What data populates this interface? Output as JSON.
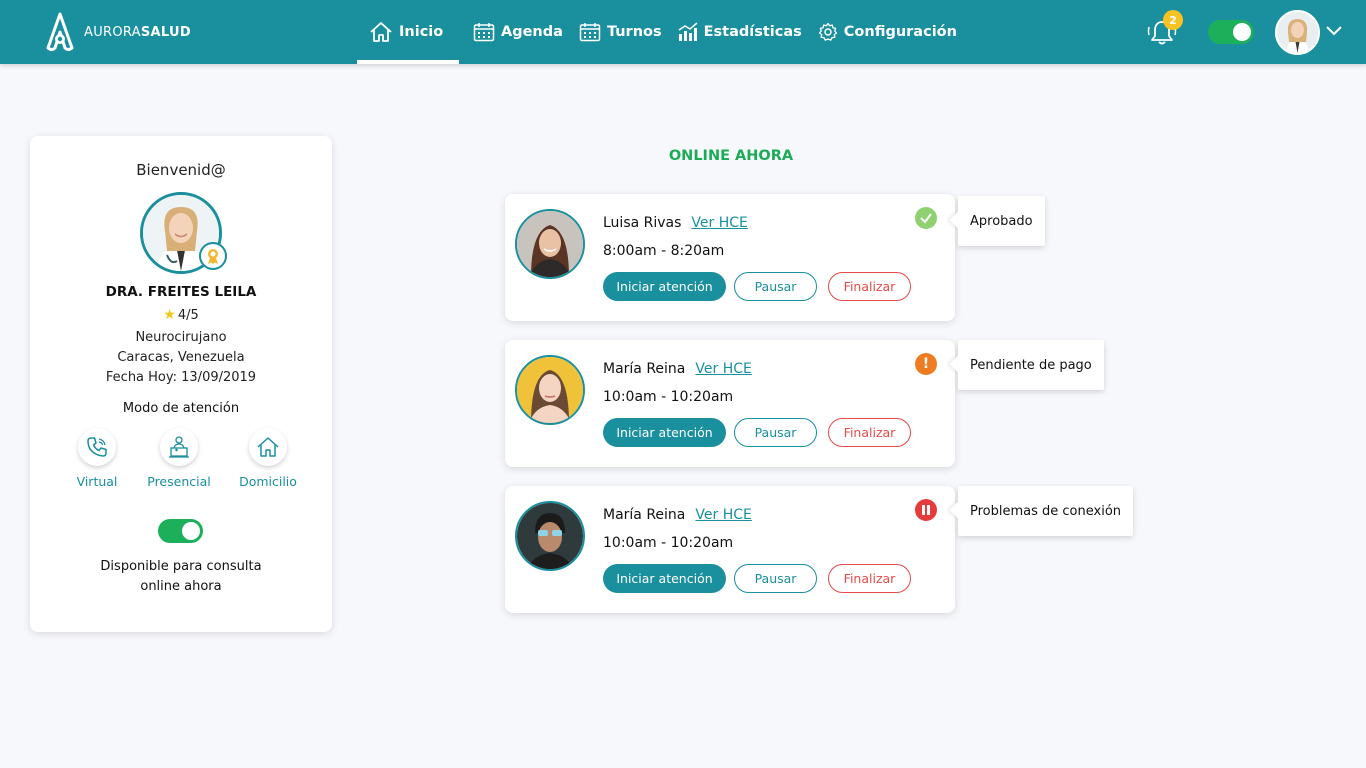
{
  "app": {
    "brand_light": "AURORA",
    "brand_bold": "SALUD"
  },
  "nav": {
    "items": [
      {
        "label": "Inicio",
        "icon": "home-icon",
        "active": true
      },
      {
        "label": "Agenda",
        "icon": "calendar-icon"
      },
      {
        "label": "Turnos",
        "icon": "calendar-icon"
      },
      {
        "label": "Estadísticas",
        "icon": "chart-icon"
      },
      {
        "label": "Configuración",
        "icon": "gear-icon"
      }
    ]
  },
  "header": {
    "notification_count": "2",
    "online_toggle": true
  },
  "profile": {
    "welcome": "Bienvenid@",
    "name": "DRA. FREITES LEILA",
    "rating": "4/5",
    "specialty": "Neurocirujano",
    "location": "Caracas, Venezuela",
    "date": "Fecha Hoy: 13/09/2019",
    "mode_title": "Modo de atención",
    "modes": [
      {
        "label": "Virtual",
        "icon": "phone-icon"
      },
      {
        "label": "Presencial",
        "icon": "clinic-icon"
      },
      {
        "label": "Domicilio",
        "icon": "home-icon"
      }
    ],
    "available_line1": "Disponible para consulta",
    "available_line2": "online ahora",
    "available": true
  },
  "online": {
    "title": "ONLINE AHORA",
    "hce_label": "Ver HCE",
    "start_label": "Iniciar atención",
    "pause_label": "Pausar",
    "end_label": "Finalizar",
    "patients": [
      {
        "name": "Luisa Rivas",
        "time": "8:00am - 8:20am",
        "status": "Aprobado",
        "status_icon": "check-icon",
        "status_color": "#8fd16f"
      },
      {
        "name": "María Reina",
        "time": "10:0am - 10:20am",
        "status": "Pendiente de pago",
        "status_icon": "alert-icon",
        "status_color": "#f07c22"
      },
      {
        "name": "María Reina",
        "time": "10:0am - 10:20am",
        "status": "Problemas de conexión",
        "status_icon": "pause-icon",
        "status_color": "#e63b3b"
      }
    ]
  },
  "colors": {
    "primary": "#1a8f9e",
    "success": "#1cb05a",
    "danger": "#e64a4a"
  }
}
